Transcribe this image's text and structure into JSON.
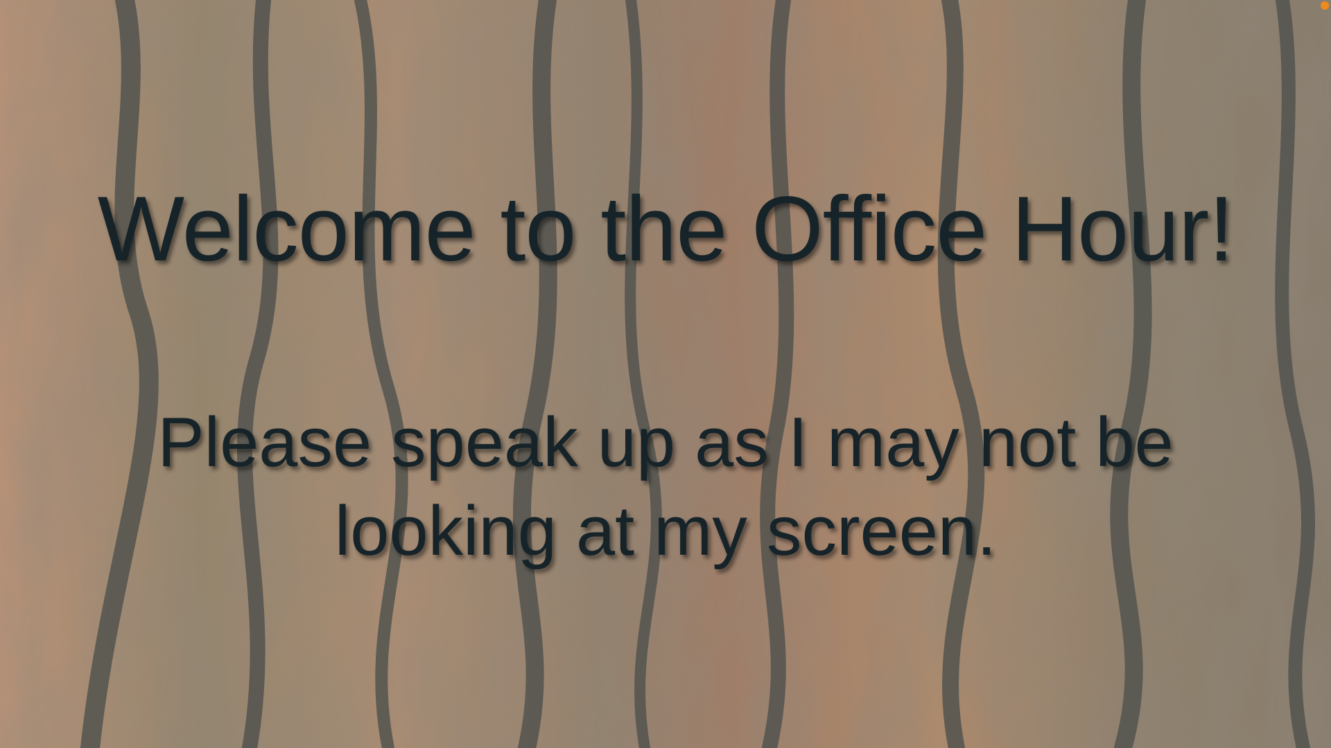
{
  "slide": {
    "title": "Welcome to the Office Hour!",
    "message_line1": "Please speak up as I may not be",
    "message_line2": "looking at my screen."
  },
  "colors": {
    "text": "#16242a",
    "indicator": "#f08a1c"
  }
}
